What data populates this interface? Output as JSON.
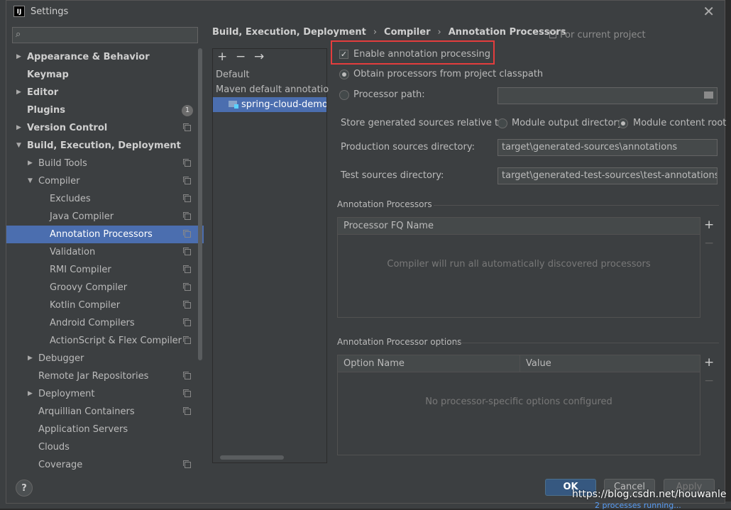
{
  "window": {
    "title": "Settings",
    "app_icon": "IJ"
  },
  "search": {
    "placeholder": "",
    "value": ""
  },
  "tree": [
    {
      "label": "Appearance & Behavior",
      "bold": true,
      "level": 0,
      "arrow": "right",
      "copy": false
    },
    {
      "label": "Keymap",
      "bold": true,
      "level": 0,
      "arrow": "",
      "copy": false
    },
    {
      "label": "Editor",
      "bold": true,
      "level": 0,
      "arrow": "right",
      "copy": false
    },
    {
      "label": "Plugins",
      "bold": true,
      "level": 0,
      "arrow": "",
      "copy": false,
      "badge": "1"
    },
    {
      "label": "Version Control",
      "bold": true,
      "level": 0,
      "arrow": "right",
      "copy": true
    },
    {
      "label": "Build, Execution, Deployment",
      "bold": true,
      "level": 0,
      "arrow": "down",
      "copy": false
    },
    {
      "label": "Build Tools",
      "bold": false,
      "level": 1,
      "arrow": "right",
      "copy": true
    },
    {
      "label": "Compiler",
      "bold": false,
      "level": 1,
      "arrow": "down",
      "copy": true
    },
    {
      "label": "Excludes",
      "bold": false,
      "level": 2,
      "arrow": "",
      "copy": true
    },
    {
      "label": "Java Compiler",
      "bold": false,
      "level": 2,
      "arrow": "",
      "copy": true
    },
    {
      "label": "Annotation Processors",
      "bold": false,
      "level": 2,
      "arrow": "",
      "copy": true,
      "selected": true
    },
    {
      "label": "Validation",
      "bold": false,
      "level": 2,
      "arrow": "",
      "copy": true
    },
    {
      "label": "RMI Compiler",
      "bold": false,
      "level": 2,
      "arrow": "",
      "copy": true
    },
    {
      "label": "Groovy Compiler",
      "bold": false,
      "level": 2,
      "arrow": "",
      "copy": true
    },
    {
      "label": "Kotlin Compiler",
      "bold": false,
      "level": 2,
      "arrow": "",
      "copy": true
    },
    {
      "label": "Android Compilers",
      "bold": false,
      "level": 2,
      "arrow": "",
      "copy": true
    },
    {
      "label": "ActionScript & Flex Compiler",
      "bold": false,
      "level": 2,
      "arrow": "",
      "copy": true
    },
    {
      "label": "Debugger",
      "bold": false,
      "level": 1,
      "arrow": "right",
      "copy": false
    },
    {
      "label": "Remote Jar Repositories",
      "bold": false,
      "level": 1,
      "arrow": "",
      "copy": true
    },
    {
      "label": "Deployment",
      "bold": false,
      "level": 1,
      "arrow": "right",
      "copy": true
    },
    {
      "label": "Arquillian Containers",
      "bold": false,
      "level": 1,
      "arrow": "",
      "copy": true
    },
    {
      "label": "Application Servers",
      "bold": false,
      "level": 1,
      "arrow": "",
      "copy": false
    },
    {
      "label": "Clouds",
      "bold": false,
      "level": 1,
      "arrow": "",
      "copy": false
    },
    {
      "label": "Coverage",
      "bold": false,
      "level": 1,
      "arrow": "",
      "copy": true
    }
  ],
  "breadcrumb": [
    "Build, Execution, Deployment",
    "Compiler",
    "Annotation Processors"
  ],
  "scope_label": "For current project",
  "modules": {
    "toolbar": [
      "+",
      "−",
      "→"
    ],
    "items": [
      {
        "label": "Default",
        "selected": false
      },
      {
        "label": "Maven default annotation p",
        "selected": false
      },
      {
        "label": "spring-cloud-demo",
        "selected": true
      }
    ]
  },
  "settings": {
    "enable_processing": {
      "label": "Enable annotation processing",
      "checked": true
    },
    "obtain_from_classpath": {
      "label": "Obtain processors from project classpath",
      "selected": true
    },
    "processor_path": {
      "label": "Processor path:",
      "selected": false,
      "value": ""
    },
    "store_generated": {
      "label": "Store generated sources relative to:",
      "option_module_output": "Module output directory",
      "option_module_content": "Module content root",
      "selected": "Module content root"
    },
    "production_dir": {
      "label": "Production sources directory:",
      "value": "target\\generated-sources\\annotations"
    },
    "test_dir": {
      "label": "Test sources directory:",
      "value": "target\\generated-test-sources\\test-annotations"
    }
  },
  "processors_section": {
    "title": "Annotation Processors",
    "column": "Processor FQ Name",
    "empty_text": "Compiler will run all automatically discovered processors",
    "add": "+",
    "remove": "−"
  },
  "options_section": {
    "title": "Annotation Processor options",
    "columns": [
      "Option Name",
      "Value"
    ],
    "empty_text": "No processor-specific options configured",
    "add": "+",
    "remove": "−"
  },
  "buttons": {
    "help": "?",
    "ok": "OK",
    "cancel": "Cancel",
    "apply": "Apply"
  },
  "watermark": "https://blog.csdn.net/houwanle",
  "background_status": "2 processes running..."
}
